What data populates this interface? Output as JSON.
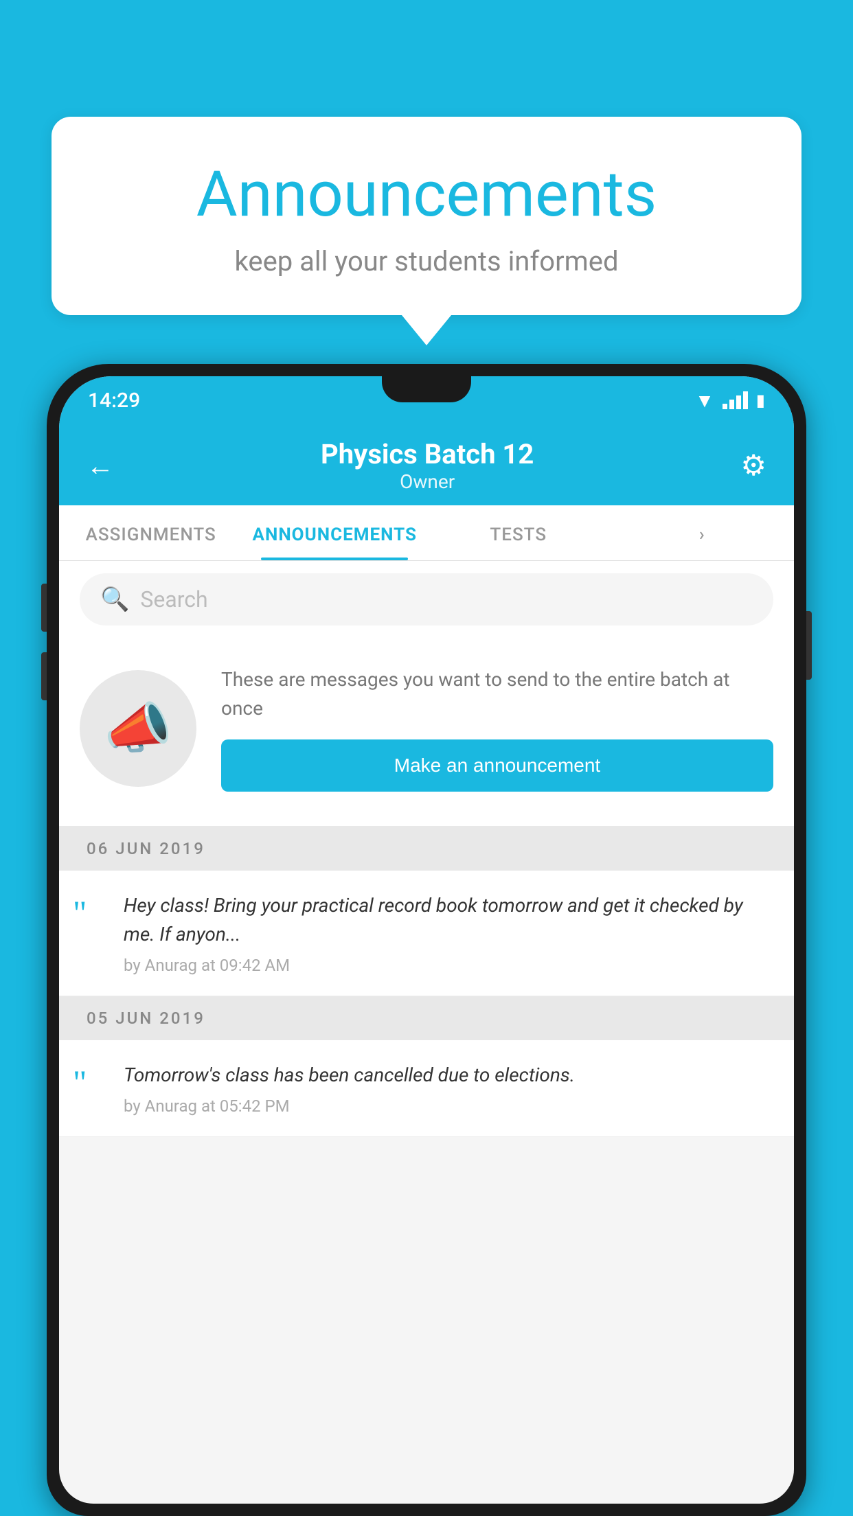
{
  "page": {
    "background_color": "#1ab8e0"
  },
  "speech_bubble": {
    "title": "Announcements",
    "subtitle": "keep all your students informed"
  },
  "status_bar": {
    "time": "14:29"
  },
  "header": {
    "title": "Physics Batch 12",
    "subtitle": "Owner",
    "back_label": "←",
    "gear_label": "⚙"
  },
  "tabs": [
    {
      "label": "ASSIGNMENTS",
      "active": false
    },
    {
      "label": "ANNOUNCEMENTS",
      "active": true
    },
    {
      "label": "TESTS",
      "active": false
    },
    {
      "label": "···",
      "active": false
    }
  ],
  "search": {
    "placeholder": "Search"
  },
  "announcement_prompt": {
    "description_text": "These are messages you want to send to the entire batch at once",
    "button_label": "Make an announcement"
  },
  "dates": [
    {
      "label": "06  JUN  2019",
      "announcements": [
        {
          "text": "Hey class! Bring your practical record book tomorrow and get it checked by me. If anyon...",
          "meta": "by Anurag at 09:42 AM"
        }
      ]
    },
    {
      "label": "05  JUN  2019",
      "announcements": [
        {
          "text": "Tomorrow's class has been cancelled due to elections.",
          "meta": "by Anurag at 05:42 PM"
        }
      ]
    }
  ]
}
